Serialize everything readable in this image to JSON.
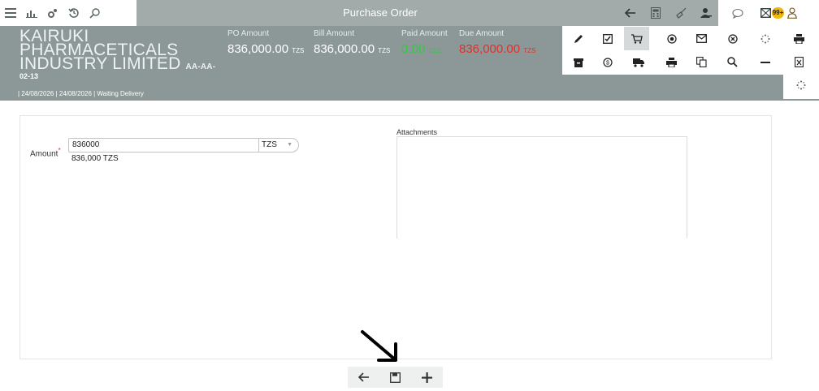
{
  "topbar": {
    "title": "Purchase Order",
    "left_icons": [
      "menu-icon",
      "chart-icon",
      "settings-icon",
      "history-icon",
      "search-icon"
    ],
    "right_icons": [
      "back-arrow-icon",
      "calculator-icon",
      "broom-icon",
      "users-icon",
      "chat-icon",
      "mail-icon",
      "user-icon"
    ],
    "notification_badge": "99+"
  },
  "header": {
    "company_name": "KAIRUKI PHARMACETICALS INDUSTRY LIMITED",
    "company_suffix": "AA-AA-",
    "code": "02-13",
    "status_line": "| 24/08/2026 | 24/08/2026 | Waiting Delivery",
    "amounts": [
      {
        "label": "PO Amount",
        "value": "836,000.00",
        "currency": "TZS"
      },
      {
        "label": "Bill Amount",
        "value": "836,000.00",
        "currency": "TZS"
      },
      {
        "label": "Paid Amount",
        "value": "0.00",
        "currency": "TZS"
      },
      {
        "label": "Due Amount",
        "value": "836,000.00",
        "currency": "TZS"
      }
    ],
    "colors": {
      "paid": "#2ecc40",
      "due": "#e0302a"
    }
  },
  "actions": {
    "row1": [
      "edit-icon",
      "checkbox-icon",
      "cart-icon",
      "record-icon",
      "mail-icon",
      "cancel-icon",
      "spinner-icon",
      "print-icon"
    ],
    "row2": [
      "archive-icon",
      "dollar-icon",
      "truck-icon",
      "print-icon",
      "copy-icon",
      "search-icon",
      "minus-icon",
      "excel-icon"
    ],
    "extra": "spinner-icon"
  },
  "form": {
    "amount_label": "Amount",
    "required_mark": "*",
    "amount_value": "836000",
    "currency": "TZS",
    "formatted_amount": "836,000 TZS",
    "attachments_label": "Attachments"
  },
  "bottom_toolbar": [
    "back-arrow-icon",
    "save-icon",
    "add-icon"
  ]
}
